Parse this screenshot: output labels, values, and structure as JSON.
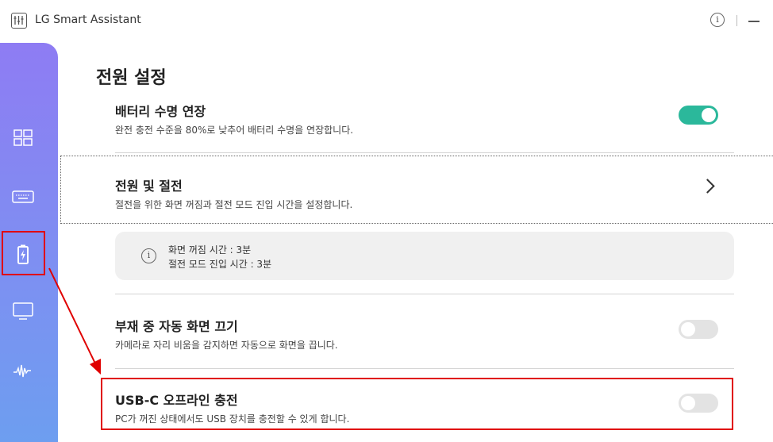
{
  "app": {
    "title": "LG Smart Assistant",
    "info_glyph": "i"
  },
  "page": {
    "title": "전원 설정"
  },
  "settings": {
    "battery": {
      "title": "배터리 수명 연장",
      "desc": "완전 충전 수준을 80%로 낮추어 배터리 수명을 연장합니다.",
      "enabled": true
    },
    "power_saving": {
      "title": "전원 및 절전",
      "desc": "절전을 위한 화면 꺼짐과 절전 모드 진입 시간을 설정합니다."
    },
    "power_info": {
      "screen_off": "화면 꺼짐 시간 : 3분",
      "sleep": "절전 모드 진입 시간 : 3분",
      "info_glyph": "i"
    },
    "auto_screen_off": {
      "title": "부재 중 자동 화면 끄기",
      "desc": "카메라로 자리 비움을 감지하면 자동으로 화면을 끕니다.",
      "enabled": false
    },
    "usb_c": {
      "title": "USB-C 오프라인 충전",
      "desc": "PC가 꺼진 상태에서도 USB 장치를 충전할 수 있게 합니다.",
      "enabled": false
    }
  },
  "sidebar": {
    "items": [
      "dashboard-icon",
      "keyboard-icon",
      "battery-icon",
      "monitor-icon",
      "audio-icon"
    ],
    "selected": "battery-icon"
  },
  "colors": {
    "accent": "#2bb89b",
    "highlight": "#e00000",
    "sidebar_top": "#8e7cf3",
    "sidebar_bottom": "#6d9ef0"
  }
}
